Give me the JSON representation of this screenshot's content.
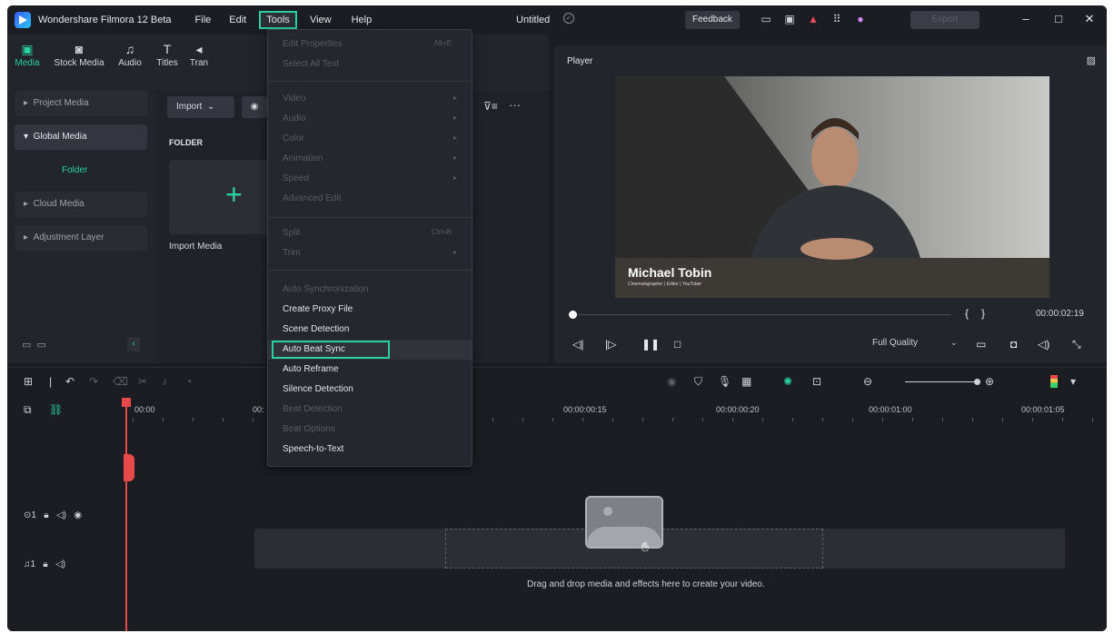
{
  "titlebar": {
    "app_name": "Wondershare Filmora 12 Beta",
    "menu": [
      "File",
      "Edit",
      "Tools",
      "View",
      "Help"
    ],
    "doc_title": "Untitled",
    "feedback": "Feedback",
    "export": "Export"
  },
  "media_tabs": [
    {
      "label": "Media",
      "icon": "media-icon"
    },
    {
      "label": "Stock Media",
      "icon": "stock-media-icon"
    },
    {
      "label": "Audio",
      "icon": "audio-icon"
    },
    {
      "label": "Titles",
      "icon": "titles-icon"
    },
    {
      "label": "Tran",
      "icon": "transitions-icon"
    }
  ],
  "sidebar": {
    "items": [
      "Project Media",
      "Global Media",
      "Folder",
      "Cloud Media",
      "Adjustment Layer"
    ]
  },
  "content": {
    "import": "Import",
    "folder_label": "FOLDER",
    "import_media": "Import Media"
  },
  "tools_menu": {
    "items": [
      {
        "label": "Edit Properties",
        "shortcut": "Alt+E",
        "enabled": false
      },
      {
        "label": "Select All Text",
        "enabled": false
      },
      {
        "label": "Video",
        "submenu": true,
        "enabled": false
      },
      {
        "label": "Audio",
        "submenu": true,
        "enabled": false
      },
      {
        "label": "Color",
        "submenu": true,
        "enabled": false
      },
      {
        "label": "Animation",
        "submenu": true,
        "enabled": false
      },
      {
        "label": "Speed",
        "submenu": true,
        "enabled": false
      },
      {
        "label": "Advanced Edit",
        "enabled": false
      },
      {
        "label": "Split",
        "shortcut": "Ctrl+B",
        "enabled": false
      },
      {
        "label": "Trim",
        "submenu": true,
        "enabled": false
      },
      {
        "label": "Auto Synchronization",
        "enabled": false
      },
      {
        "label": "Create Proxy File",
        "enabled": true
      },
      {
        "label": "Scene Detection",
        "enabled": true
      },
      {
        "label": "Auto Beat Sync",
        "enabled": true,
        "highlighted": true
      },
      {
        "label": "Auto Reframe",
        "enabled": true
      },
      {
        "label": "Silence Detection",
        "enabled": true
      },
      {
        "label": "Beat Detection",
        "enabled": false
      },
      {
        "label": "Beat Options",
        "enabled": false
      },
      {
        "label": "Speech-to-Text",
        "enabled": true
      }
    ]
  },
  "player": {
    "title": "Player",
    "name_overlay": "Michael Tobin",
    "subtitle_overlay": "Cinematographer | Editor | YouTuber",
    "timecode": "00:00:02:19",
    "quality": "Full Quality"
  },
  "timeline": {
    "ruler": [
      "00:00",
      "00:",
      "00:00:00:15",
      "00:00:00:20",
      "00:00:01:00",
      "00:00:01:05"
    ],
    "video_track": "1",
    "audio_track": "1",
    "drop_hint": "Drag and drop media and effects here to create your video."
  },
  "colors": {
    "accent": "#2ad1a1",
    "background": "#1b1d22",
    "playhead": "#e84a4a"
  }
}
